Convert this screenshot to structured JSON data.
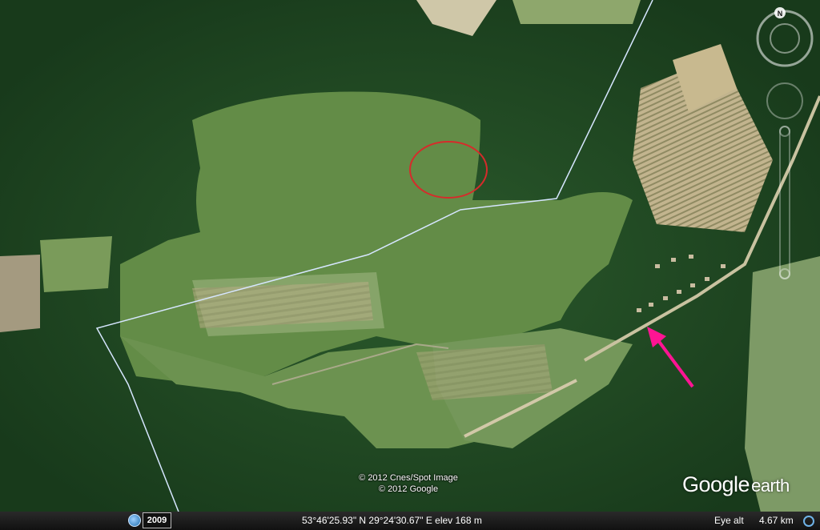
{
  "attribution": {
    "line1": "© 2012 Cnes/Spot Image",
    "line2": "© 2012 Google"
  },
  "logo": {
    "google": "Google",
    "earth": "earth"
  },
  "status_bar": {
    "year": "2009",
    "coordinates": "53°46'25.93\" N  29°24'30.67\" E  elev   168 m",
    "eye_alt_label": "Eye alt",
    "eye_alt_value": "4.67 km"
  },
  "navigation": {
    "north_label": "N"
  },
  "colors": {
    "boundary": "#d6e6ff",
    "circle_marker": "#d62b2b",
    "arrow_marker": "#ff1493",
    "forest": "#1f4a22",
    "meadow": "#5d8a45"
  },
  "icons": [
    "history-icon",
    "streaming-icon",
    "compass-icon",
    "look-joystick-icon",
    "zoom-slider-icon"
  ]
}
